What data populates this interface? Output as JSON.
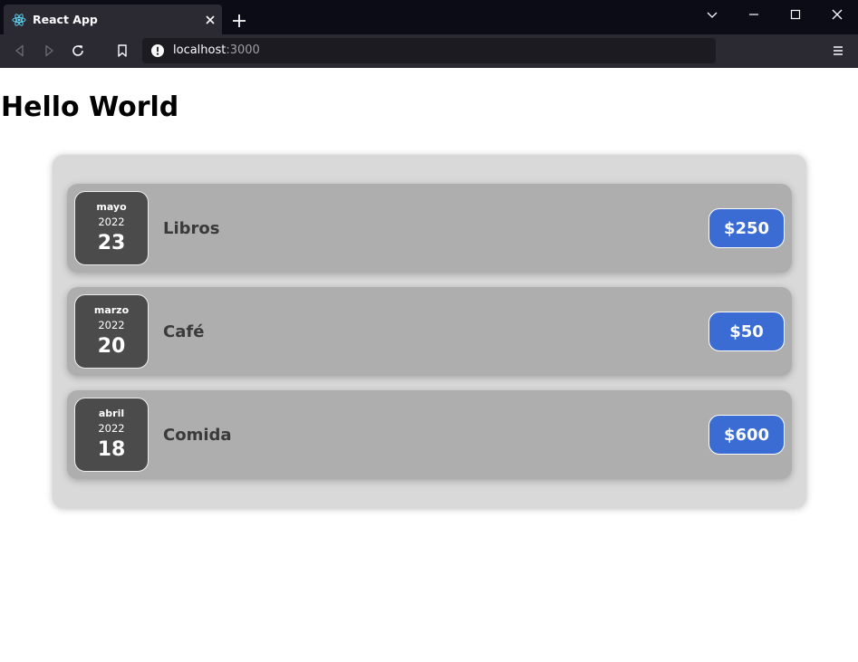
{
  "browser": {
    "tab_title": "React App",
    "url_host": "localhost",
    "url_port": ":3000"
  },
  "page": {
    "heading": "Hello World"
  },
  "expenses": [
    {
      "month": "mayo",
      "year": "2022",
      "day": "23",
      "title": "Libros",
      "amount": "$250"
    },
    {
      "month": "marzo",
      "year": "2022",
      "day": "20",
      "title": "Café",
      "amount": "$50"
    },
    {
      "month": "abril",
      "year": "2022",
      "day": "18",
      "title": "Comida",
      "amount": "$600"
    }
  ],
  "colors": {
    "price_badge": "#3a6cd4",
    "item_bg": "#aeaeae",
    "list_bg": "#d9d9d9",
    "date_bg": "#4b4b4b"
  }
}
